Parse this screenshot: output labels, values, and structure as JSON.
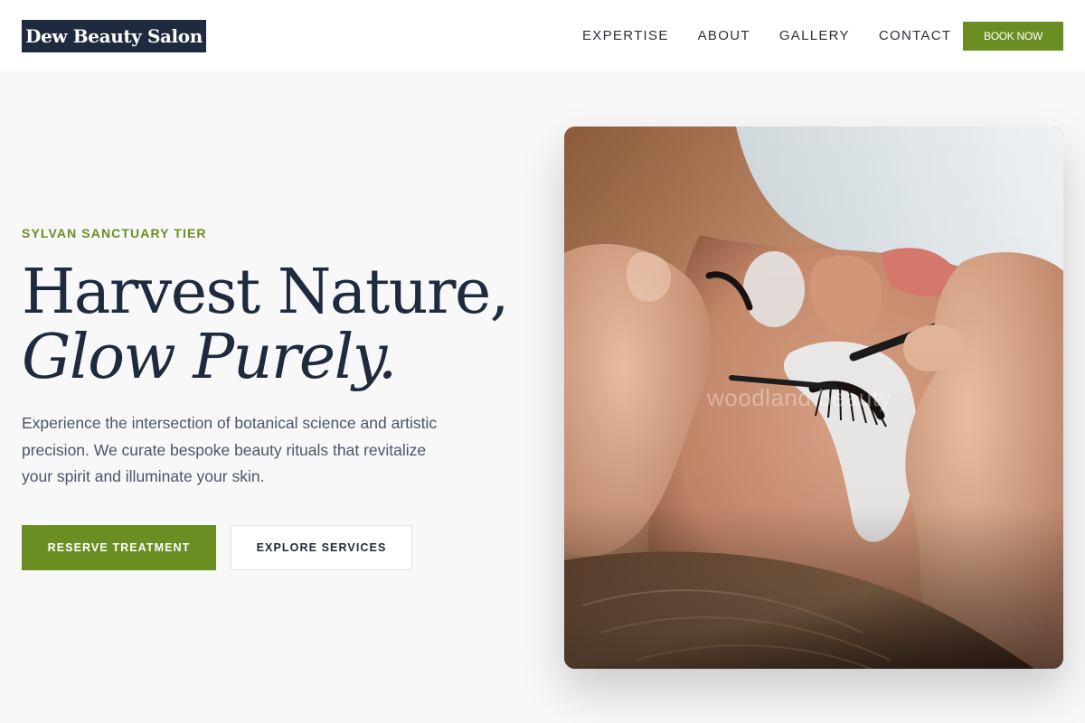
{
  "brand": {
    "name": "Dew Beauty Salon"
  },
  "nav": {
    "items": [
      "EXPERTISE",
      "ABOUT",
      "GALLERY",
      "CONTACT"
    ],
    "cta": "BOOK NOW"
  },
  "hero": {
    "eyebrow": "SYLVAN SANCTUARY TIER",
    "headline_line1": "Harvest Nature,",
    "headline_line2": "Glow Purely.",
    "lede": "Experience the intersection of botanical science and artistic precision. We curate bespoke beauty rituals that revitalize your spirit and illuminate your skin.",
    "primary_cta": "RESERVE TREATMENT",
    "secondary_cta": "EXPLORE SERVICES"
  },
  "photo": {
    "watermark": "woodland beauty",
    "subject": "eyelash extension treatment close-up"
  },
  "colors": {
    "accent": "#6b8e23",
    "navy": "#1e2a3d",
    "background": "#f8f8f8"
  }
}
